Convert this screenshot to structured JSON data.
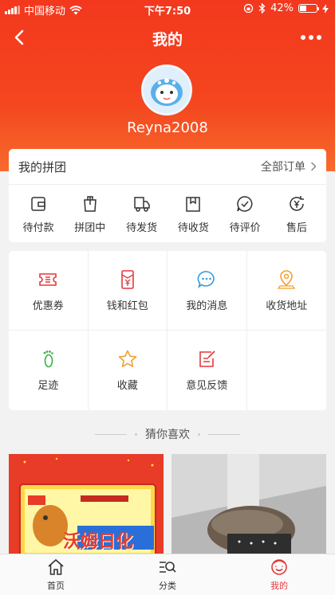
{
  "status_bar": {
    "carrier": "中国移动",
    "time": "下午7:50",
    "battery": "42%",
    "battery_level": 0.42
  },
  "nav": {
    "title": "我的"
  },
  "profile": {
    "username": "Reyna2008"
  },
  "group_card": {
    "title": "我的拼团",
    "all_orders": "全部订单",
    "items": [
      {
        "label": "待付款",
        "icon": "wallet-icon"
      },
      {
        "label": "拼团中",
        "icon": "bag-icon"
      },
      {
        "label": "待发货",
        "icon": "truck-icon"
      },
      {
        "label": "待收货",
        "icon": "box-icon"
      },
      {
        "label": "待评价",
        "icon": "comment-check-icon"
      },
      {
        "label": "售后",
        "icon": "yen-refresh-icon"
      }
    ]
  },
  "services": [
    {
      "label": "优惠券",
      "icon": "coupon-icon",
      "color": "#e4393c"
    },
    {
      "label": "钱和红包",
      "icon": "red-packet-icon",
      "color": "#e4393c"
    },
    {
      "label": "我的消息",
      "icon": "message-icon",
      "color": "#3a9ad9"
    },
    {
      "label": "收货地址",
      "icon": "location-icon",
      "color": "#f0a030"
    },
    {
      "label": "足迹",
      "icon": "footprint-icon",
      "color": "#3ab24a"
    },
    {
      "label": "收藏",
      "icon": "star-icon",
      "color": "#f0a030"
    },
    {
      "label": "意见反馈",
      "icon": "feedback-icon",
      "color": "#e4393c"
    }
  ],
  "recommend": {
    "title": "猜你喜欢"
  },
  "products": [
    {
      "banner_text": "沃姆日化"
    },
    {
      "banner_text": ""
    }
  ],
  "tabbar": [
    {
      "label": "首页",
      "icon": "home-icon"
    },
    {
      "label": "分类",
      "icon": "category-search-icon"
    },
    {
      "label": "我的",
      "icon": "user-smile-icon",
      "active": true
    }
  ],
  "colors": {
    "primary": "#f3381e",
    "accent": "#e4393c"
  }
}
